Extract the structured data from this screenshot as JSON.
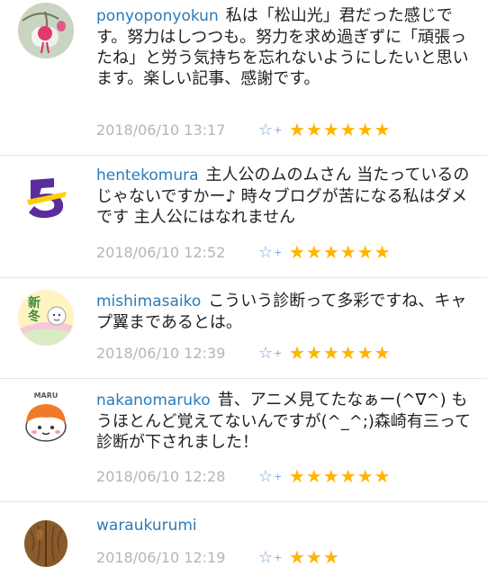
{
  "comments": [
    {
      "username": "ponyoponyokun",
      "text": "私は「松山光」君だった感じです。努力はしつつも。努力を求め過ぎずに「頑張ったね」と労う気持ちを忘れないようにしたいと思います。楽しい記事、感謝です。",
      "date": "2018/06/10 13:17",
      "stars": "★★★★★★",
      "avatar_icon": "flower-avatar-icon"
    },
    {
      "username": "hentekomura",
      "text": "主人公のムのムさん 当たっているのじゃないですかー♪ 時々ブログが苦になる私はダメです 主人公にはなれません",
      "date": "2018/06/10 12:52",
      "stars": "★★★★★★",
      "avatar_icon": "purple-logo-avatar-icon"
    },
    {
      "username": "mishimasaiko",
      "text": "こういう診断って多彩ですね、キャプ翼まであるとは。",
      "date": "2018/06/10 12:39",
      "stars": "★★★★★★",
      "avatar_icon": "shinto-character-avatar-icon",
      "avatar_text": "新冬"
    },
    {
      "username": "nakanomaruko",
      "text": "昔、アニメ見てたなぁー(^∇^) もうほとんど覚えてないんですが(^_^;)森崎有三って診断が下されました！",
      "date": "2018/06/10 12:28",
      "stars": "★★★★★★",
      "avatar_icon": "maru-character-avatar-icon",
      "avatar_text": "MARU"
    },
    {
      "username": "waraukurumi",
      "text": "",
      "date": "2018/06/10 12:19",
      "stars": "★★★",
      "avatar_icon": "walnut-avatar-icon"
    }
  ],
  "fav_icon": "☆",
  "fav_plus": "+",
  "colors": {
    "username": "#2b7bb9",
    "date": "#b5b5b5",
    "star": "#ffb400",
    "fav": "#7aa8d8"
  }
}
